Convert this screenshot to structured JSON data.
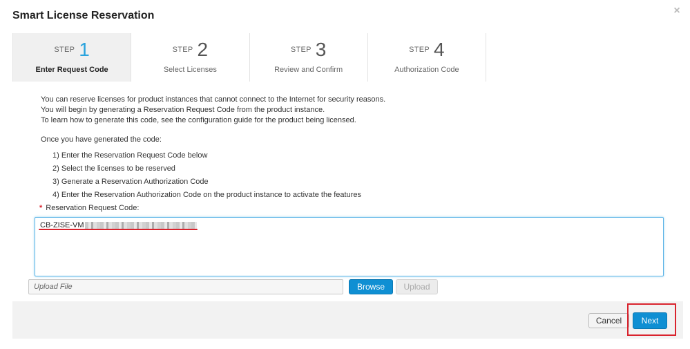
{
  "dialog": {
    "title": "Smart License Reservation",
    "close_icon": "close-icon",
    "close_glyph": "×"
  },
  "wizard": {
    "steps": [
      {
        "word": "STEP",
        "number": "1",
        "label": "Enter Request Code",
        "active": true
      },
      {
        "word": "STEP",
        "number": "2",
        "label": "Select Licenses",
        "active": false
      },
      {
        "word": "STEP",
        "number": "3",
        "label": "Review and Confirm",
        "active": false
      },
      {
        "word": "STEP",
        "number": "4",
        "label": "Authorization Code",
        "active": false
      }
    ]
  },
  "content": {
    "intro": [
      "You can reserve licenses for product instances that cannot connect to the Internet for security reasons.",
      "You will begin by generating a Reservation Request Code from the product instance.",
      "To learn how to generate this code, see the configuration guide for the product being licensed."
    ],
    "once_text": "Once you have generated the code:",
    "instructions": [
      "1) Enter the Reservation Request Code below",
      "2) Select the licenses to be reserved",
      "3) Generate a Reservation Authorization Code",
      "4) Enter the Reservation Authorization Code on the product instance to activate the features"
    ],
    "request_code_label": "Reservation Request Code:",
    "required_marker": "*",
    "request_code_value": "CB-ZISE-VM"
  },
  "upload": {
    "placeholder": "Upload File",
    "browse_label": "Browse",
    "upload_label": "Upload"
  },
  "footer": {
    "cancel_label": "Cancel",
    "next_label": "Next"
  },
  "colors": {
    "accent": "#0f8fd3",
    "active_step_number": "#29a3dd",
    "annotation_red": "#d9232d"
  }
}
